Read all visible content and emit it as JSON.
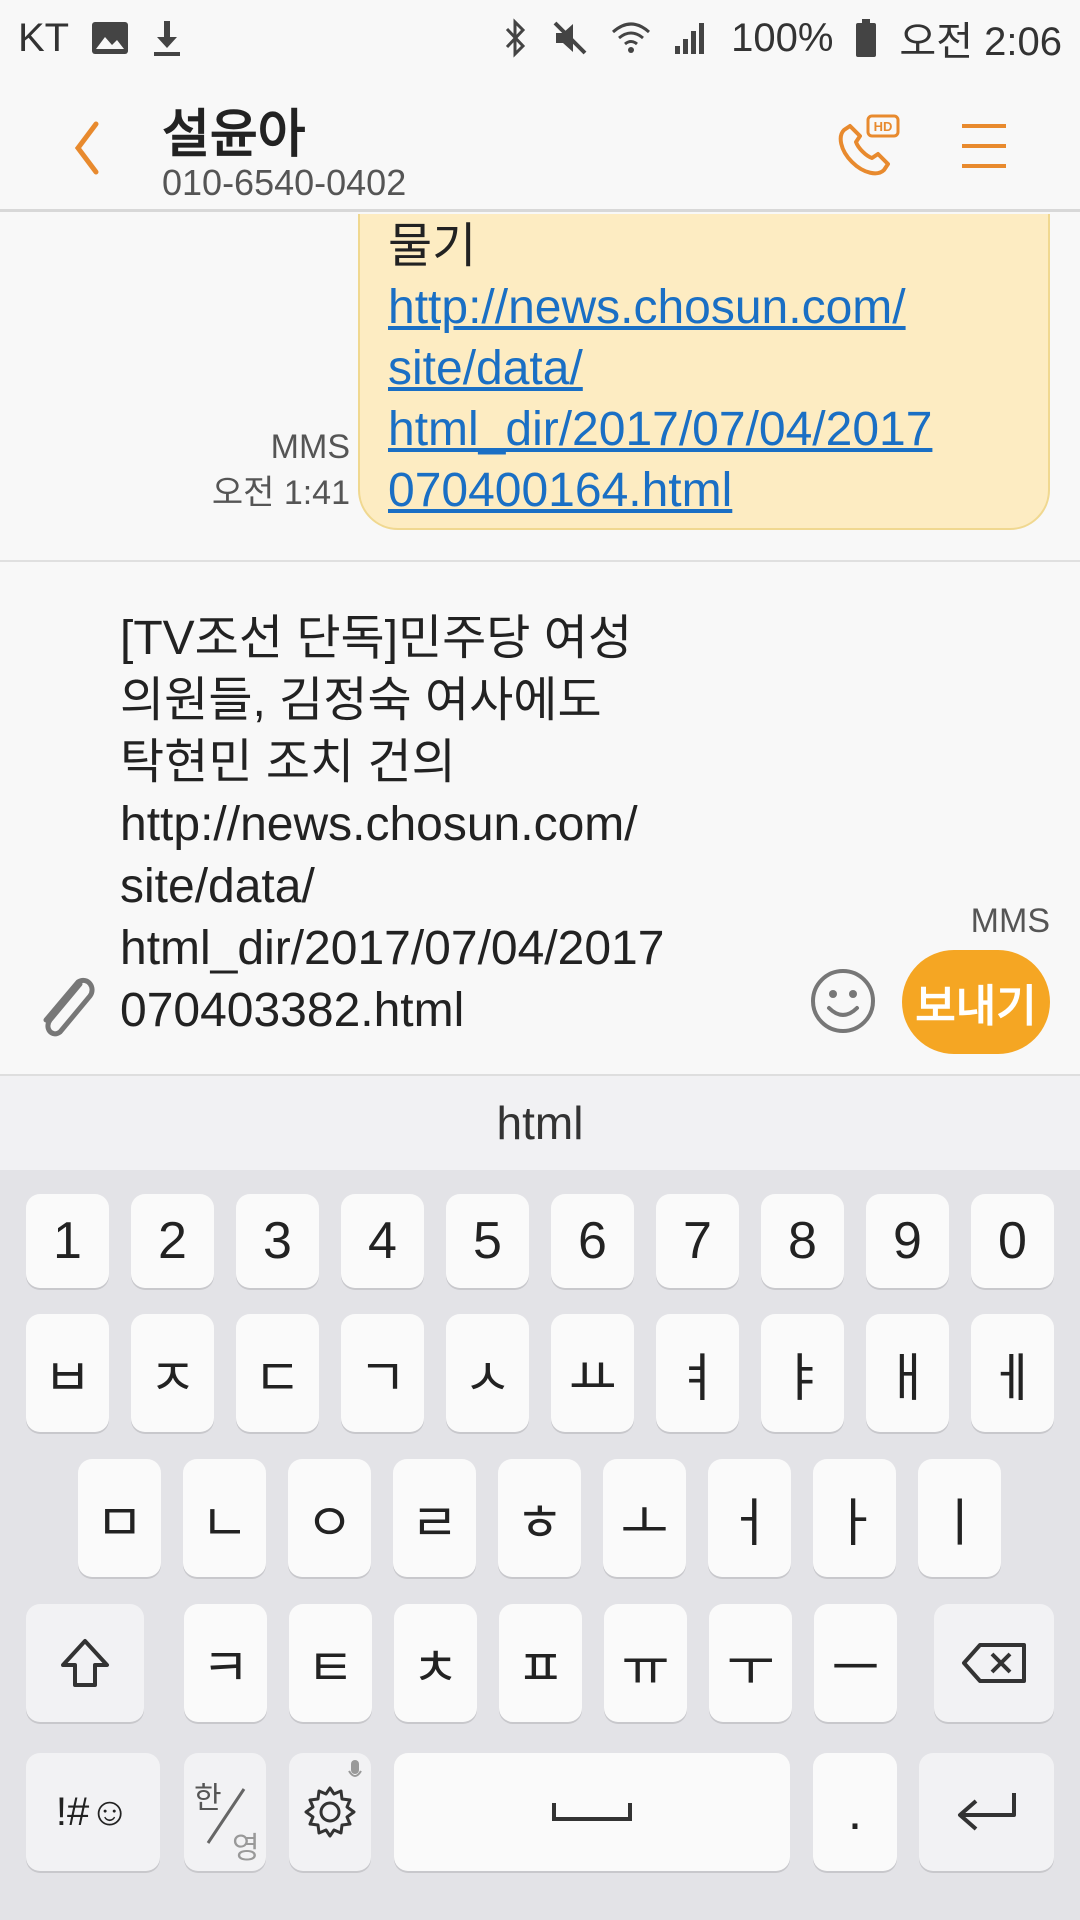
{
  "status_bar": {
    "carrier": "KT",
    "battery": "100%",
    "time": "오전 2:06"
  },
  "header": {
    "contact_name": "설윤아",
    "contact_number": "010-6540-0402"
  },
  "conversation": {
    "bubble_cut_text": "물기",
    "bubble_link_lines": [
      "http://news.chosun.com/",
      "site/data/",
      "html_dir/2017/07/04/2017",
      "070400164.html"
    ],
    "message_type": "MMS",
    "message_time": "오전 1:41"
  },
  "composer": {
    "text": "[TV조선 단독]민주당 여성\n의원들, 김정숙 여사에도\n탁현민 조치 건의\nhttp://news.chosun.com/\nsite/data/\nhtml_dir/2017/07/04/2017\n070403382.html",
    "message_type": "MMS",
    "send_label": "보내기"
  },
  "suggestion": "html",
  "keyboard": {
    "row_numbers": [
      "1",
      "2",
      "3",
      "4",
      "5",
      "6",
      "7",
      "8",
      "9",
      "0"
    ],
    "row_1": [
      "ㅂ",
      "ㅈ",
      "ㄷ",
      "ㄱ",
      "ㅅ",
      "ㅛ",
      "ㅕ",
      "ㅑ",
      "ㅐ",
      "ㅔ"
    ],
    "row_2": [
      "ㅁ",
      "ㄴ",
      "ㅇ",
      "ㄹ",
      "ㅎ",
      "ㅗ",
      "ㅓ",
      "ㅏ",
      "ㅣ"
    ],
    "row_3": [
      "ㅋ",
      "ㅌ",
      "ㅊ",
      "ㅍ",
      "ㅠ",
      "ㅜ",
      "ㅡ"
    ],
    "symbols_label": "!#☺",
    "lang_top": "한",
    "lang_bottom": "영",
    "period": "."
  },
  "colors": {
    "accent": "#e88a2e",
    "send_button": "#f5a623",
    "bubble": "#fdecc2",
    "link": "#1a6fc4"
  },
  "icons": [
    "image-icon",
    "download-icon",
    "bluetooth-icon",
    "mute-icon",
    "wifi-icon",
    "signal-icon",
    "battery-icon",
    "back-arrow-icon",
    "hd-call-icon",
    "menu-icon",
    "paperclip-icon",
    "emoji-icon",
    "shift-icon",
    "backspace-icon",
    "settings-icon",
    "space-icon",
    "enter-icon"
  ]
}
